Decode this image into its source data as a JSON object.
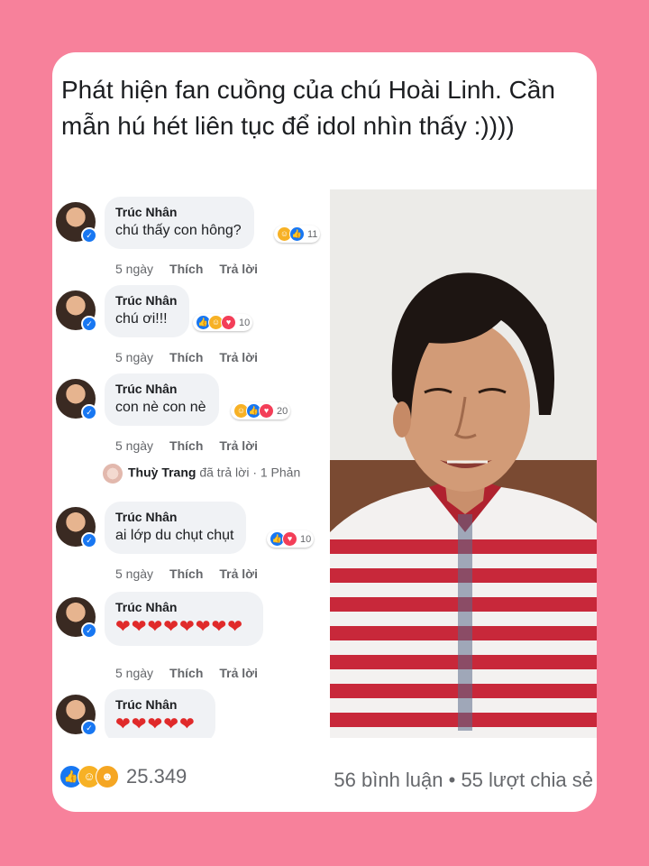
{
  "caption": "Phát hiện fan cuồng của chú Hoài Linh. Cần mẫn hú hét liên tục để idol nhìn thấy :))))",
  "comments": [
    {
      "name": "Trúc Nhân",
      "text": "chú thấy con hông?",
      "reacts": [
        "haha",
        "like"
      ],
      "count": "11",
      "time": "5 ngày",
      "like": "Thích",
      "reply": "Trả lời"
    },
    {
      "name": "Trúc Nhân",
      "text": "chú ơi!!!",
      "reacts": [
        "like",
        "haha",
        "love"
      ],
      "count": "10",
      "time": "5 ngày",
      "like": "Thích",
      "reply": "Trả lời"
    },
    {
      "name": "Trúc Nhân",
      "text": "con nè con nè",
      "reacts": [
        "haha",
        "like",
        "love"
      ],
      "count": "20",
      "time": "5 ngày",
      "like": "Thích",
      "reply": "Trả lời"
    },
    {
      "name": "Trúc Nhân",
      "text": "ai lớp du chụt chụt",
      "reacts": [
        "like",
        "love"
      ],
      "count": "10",
      "time": "5 ngày",
      "like": "Thích",
      "reply": "Trả lời"
    },
    {
      "name": "Trúc Nhân",
      "text": "❤❤❤❤❤❤❤❤",
      "time": "5 ngày",
      "like": "Thích",
      "reply": "Trả lời"
    },
    {
      "name": "Trúc Nhân",
      "text": "❤❤❤❤❤"
    }
  ],
  "reply_notice": {
    "name": "Thuỳ Trang",
    "text": "đã trả lời · 1 Phản"
  },
  "footer": {
    "reaction_count": "25.349",
    "stats": "56 bình luận • 55 lượt chia sẻ"
  },
  "colors": {
    "background": "#f7819b",
    "like": "#1877f2",
    "haha": "#f7b125",
    "love": "#f33e58"
  }
}
